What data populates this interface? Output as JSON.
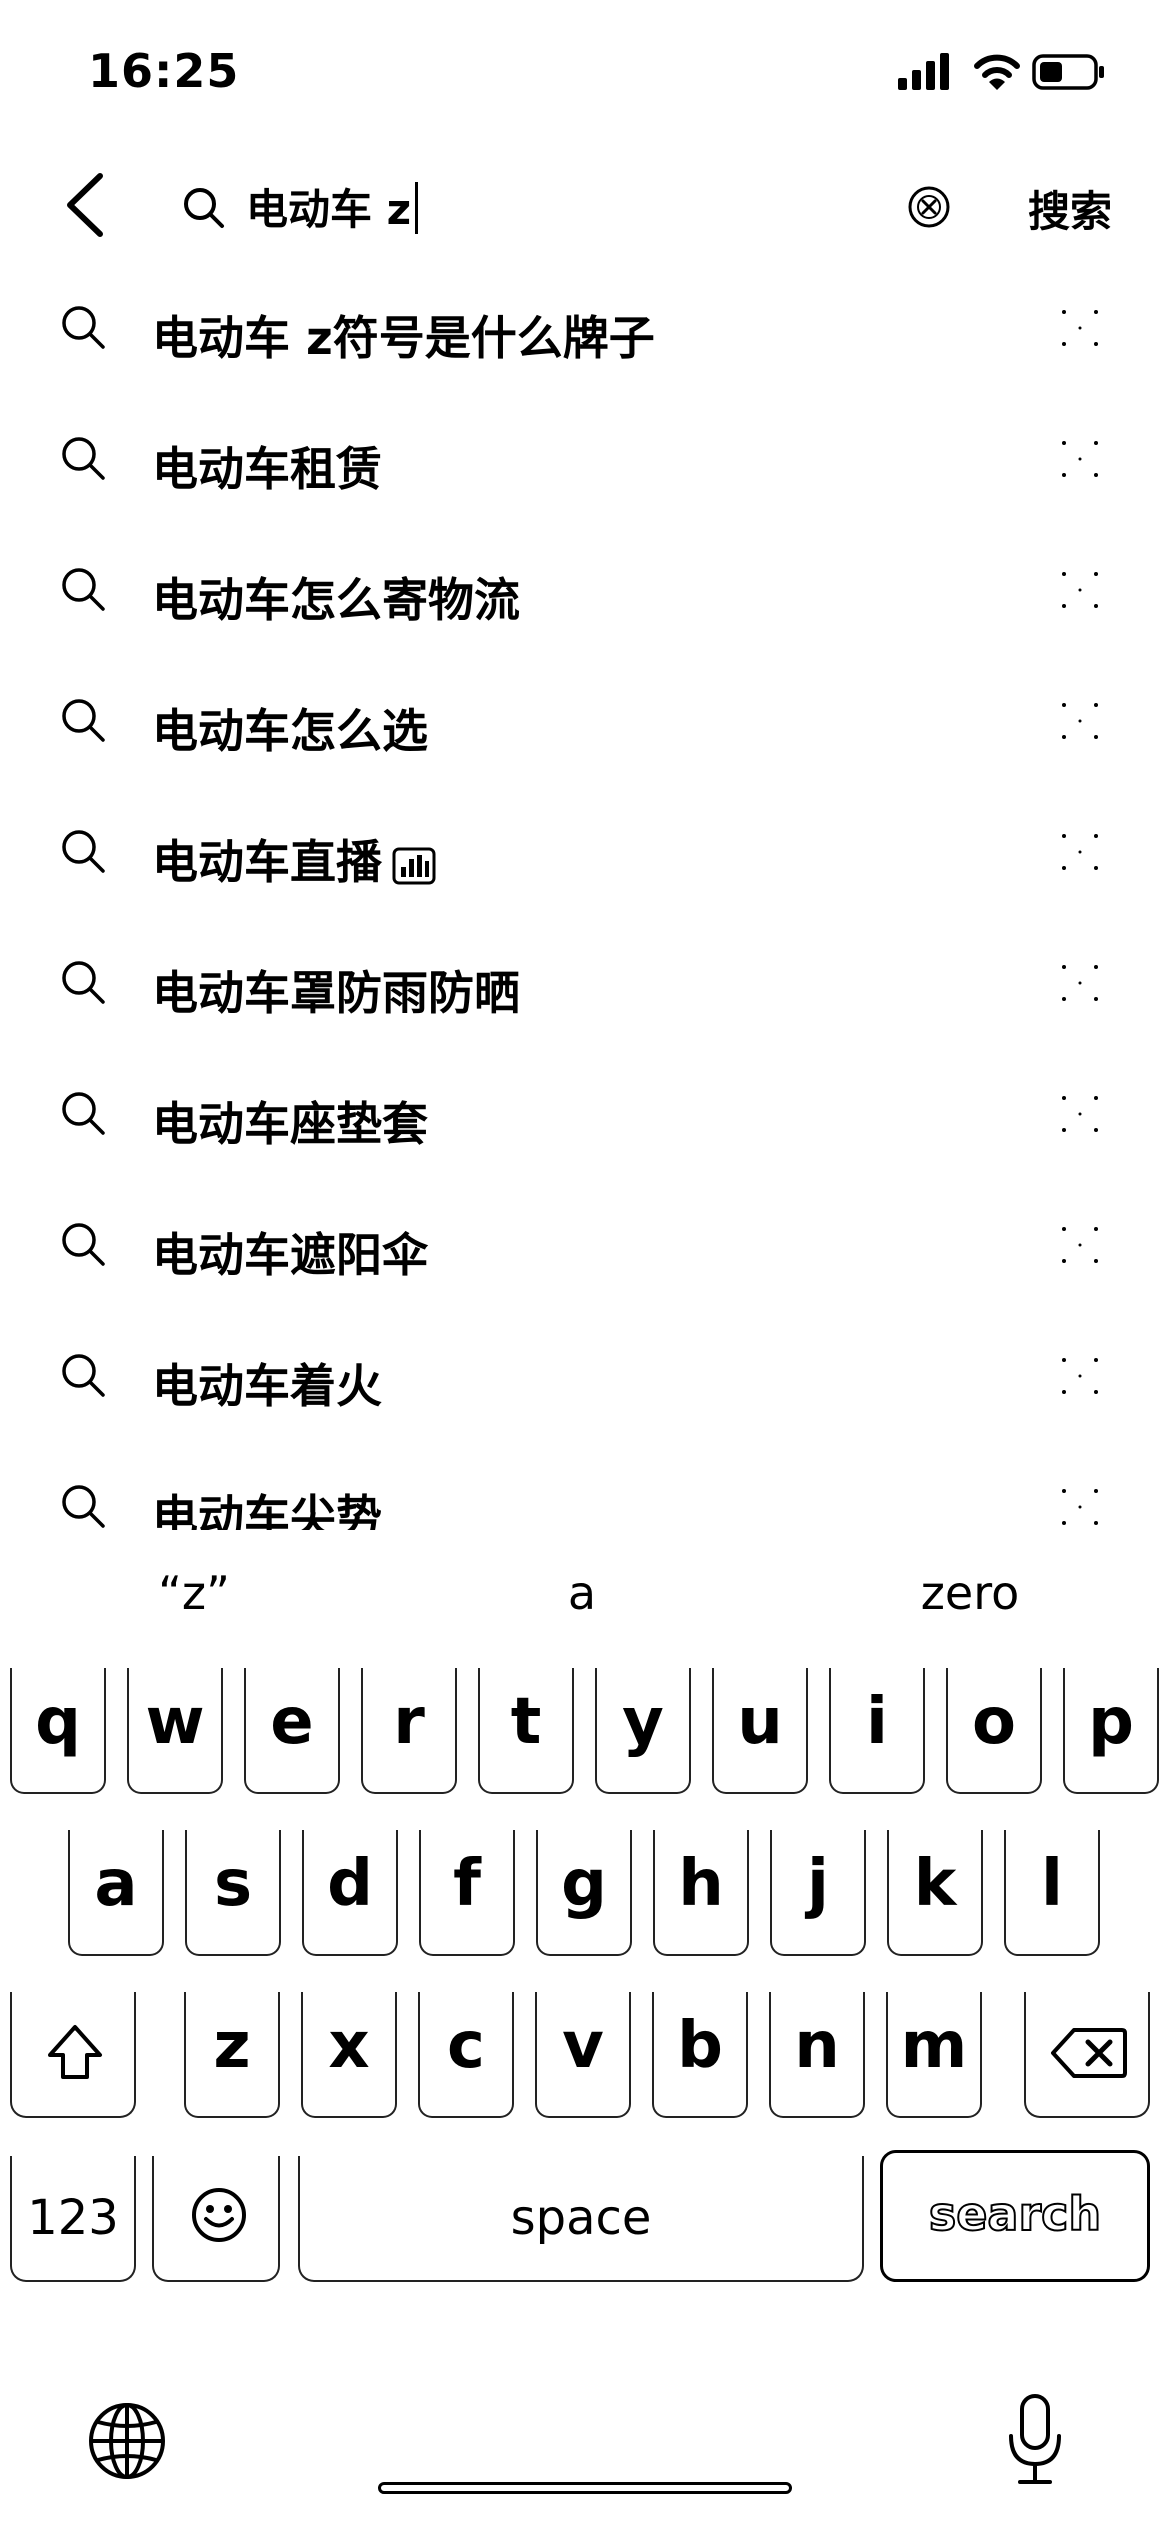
{
  "status_bar": {
    "time": "16:25"
  },
  "search": {
    "query": "电动车 z",
    "button_label": "搜索"
  },
  "suggestions": [
    {
      "text": "电动车 z符号是什么牌子",
      "live": false
    },
    {
      "text": "电动车租赁",
      "live": false
    },
    {
      "text": "电动车怎么寄物流",
      "live": false
    },
    {
      "text": "电动车怎么选",
      "live": false
    },
    {
      "text": "电动车直播",
      "live": true
    },
    {
      "text": "电动车罩防雨防晒",
      "live": false
    },
    {
      "text": "电动车座垫套",
      "live": false
    },
    {
      "text": "电动车遮阳伞",
      "live": false
    },
    {
      "text": "电动车着火",
      "live": false
    },
    {
      "text": "电动车尖势",
      "live": false
    }
  ],
  "predictive": [
    "“z”",
    "a",
    "zero"
  ],
  "keyboard": {
    "row1": [
      "q",
      "w",
      "e",
      "r",
      "t",
      "y",
      "u",
      "i",
      "o",
      "p"
    ],
    "row2": [
      "a",
      "s",
      "d",
      "f",
      "g",
      "h",
      "j",
      "k",
      "l"
    ],
    "row3": [
      "z",
      "x",
      "c",
      "v",
      "b",
      "n",
      "m"
    ],
    "numbers_label": "123",
    "space_label": "space",
    "search_label": "search"
  }
}
